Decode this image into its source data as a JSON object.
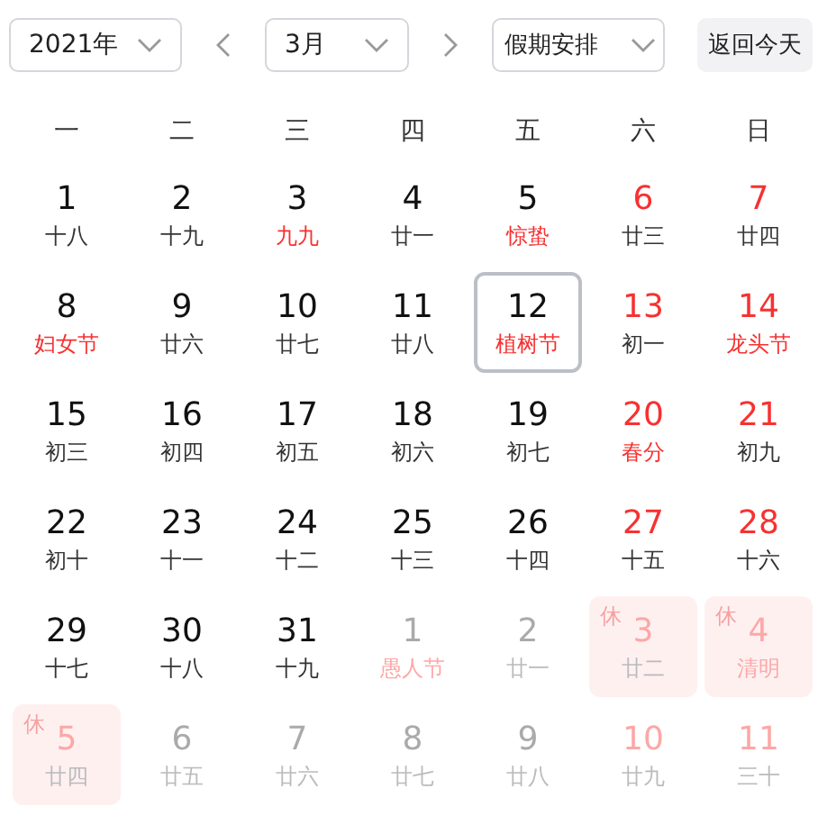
{
  "toolbar": {
    "year": "2021年",
    "month": "3月",
    "holiday": "假期安排",
    "today_button": "返回今天"
  },
  "weekdays": [
    "一",
    "二",
    "三",
    "四",
    "五",
    "六",
    "日"
  ],
  "days": [
    {
      "day": "1",
      "lunar": "十八",
      "red": false,
      "festival": false,
      "other_month": false,
      "selected": false
    },
    {
      "day": "2",
      "lunar": "十九",
      "red": false,
      "festival": false,
      "other_month": false,
      "selected": false
    },
    {
      "day": "3",
      "lunar": "九九",
      "red": false,
      "festival": true,
      "other_month": false,
      "selected": false
    },
    {
      "day": "4",
      "lunar": "廿一",
      "red": false,
      "festival": false,
      "other_month": false,
      "selected": false
    },
    {
      "day": "5",
      "lunar": "惊蛰",
      "red": false,
      "festival": true,
      "other_month": false,
      "selected": false
    },
    {
      "day": "6",
      "lunar": "廿三",
      "red": true,
      "festival": false,
      "other_month": false,
      "selected": false
    },
    {
      "day": "7",
      "lunar": "廿四",
      "red": true,
      "festival": false,
      "other_month": false,
      "selected": false
    },
    {
      "day": "8",
      "lunar": "妇女节",
      "red": false,
      "festival": true,
      "other_month": false,
      "selected": false
    },
    {
      "day": "9",
      "lunar": "廿六",
      "red": false,
      "festival": false,
      "other_month": false,
      "selected": false
    },
    {
      "day": "10",
      "lunar": "廿七",
      "red": false,
      "festival": false,
      "other_month": false,
      "selected": false
    },
    {
      "day": "11",
      "lunar": "廿八",
      "red": false,
      "festival": false,
      "other_month": false,
      "selected": false
    },
    {
      "day": "12",
      "lunar": "植树节",
      "red": false,
      "festival": true,
      "other_month": false,
      "selected": true
    },
    {
      "day": "13",
      "lunar": "初一",
      "red": true,
      "festival": false,
      "other_month": false,
      "selected": false
    },
    {
      "day": "14",
      "lunar": "龙头节",
      "red": true,
      "festival": true,
      "other_month": false,
      "selected": false
    },
    {
      "day": "15",
      "lunar": "初三",
      "red": false,
      "festival": false,
      "other_month": false,
      "selected": false
    },
    {
      "day": "16",
      "lunar": "初四",
      "red": false,
      "festival": false,
      "other_month": false,
      "selected": false
    },
    {
      "day": "17",
      "lunar": "初五",
      "red": false,
      "festival": false,
      "other_month": false,
      "selected": false
    },
    {
      "day": "18",
      "lunar": "初六",
      "red": false,
      "festival": false,
      "other_month": false,
      "selected": false
    },
    {
      "day": "19",
      "lunar": "初七",
      "red": false,
      "festival": false,
      "other_month": false,
      "selected": false
    },
    {
      "day": "20",
      "lunar": "春分",
      "red": true,
      "festival": true,
      "other_month": false,
      "selected": false
    },
    {
      "day": "21",
      "lunar": "初九",
      "red": true,
      "festival": false,
      "other_month": false,
      "selected": false
    },
    {
      "day": "22",
      "lunar": "初十",
      "red": false,
      "festival": false,
      "other_month": false,
      "selected": false
    },
    {
      "day": "23",
      "lunar": "十一",
      "red": false,
      "festival": false,
      "other_month": false,
      "selected": false
    },
    {
      "day": "24",
      "lunar": "十二",
      "red": false,
      "festival": false,
      "other_month": false,
      "selected": false
    },
    {
      "day": "25",
      "lunar": "十三",
      "red": false,
      "festival": false,
      "other_month": false,
      "selected": false
    },
    {
      "day": "26",
      "lunar": "十四",
      "red": false,
      "festival": false,
      "other_month": false,
      "selected": false
    },
    {
      "day": "27",
      "lunar": "十五",
      "red": true,
      "festival": false,
      "other_month": false,
      "selected": false
    },
    {
      "day": "28",
      "lunar": "十六",
      "red": true,
      "festival": false,
      "other_month": false,
      "selected": false
    },
    {
      "day": "29",
      "lunar": "十七",
      "red": false,
      "festival": false,
      "other_month": false,
      "selected": false
    },
    {
      "day": "30",
      "lunar": "十八",
      "red": false,
      "festival": false,
      "other_month": false,
      "selected": false
    },
    {
      "day": "31",
      "lunar": "十九",
      "red": false,
      "festival": false,
      "other_month": false,
      "selected": false
    },
    {
      "day": "1",
      "lunar": "愚人节",
      "red": false,
      "festival": true,
      "other_month": true,
      "selected": false
    },
    {
      "day": "2",
      "lunar": "廿一",
      "red": false,
      "festival": false,
      "other_month": true,
      "selected": false
    },
    {
      "day": "3",
      "lunar": "廿二",
      "red": true,
      "festival": false,
      "other_month": true,
      "selected": false,
      "rest_label": "休"
    },
    {
      "day": "4",
      "lunar": "清明",
      "red": true,
      "festival": true,
      "other_month": true,
      "selected": false,
      "rest_label": "休"
    },
    {
      "day": "5",
      "lunar": "廿四",
      "red": true,
      "festival": false,
      "other_month": true,
      "selected": false,
      "rest_label": "休"
    },
    {
      "day": "6",
      "lunar": "廿五",
      "red": false,
      "festival": false,
      "other_month": true,
      "selected": false
    },
    {
      "day": "7",
      "lunar": "廿六",
      "red": false,
      "festival": false,
      "other_month": true,
      "selected": false
    },
    {
      "day": "8",
      "lunar": "廿七",
      "red": false,
      "festival": false,
      "other_month": true,
      "selected": false
    },
    {
      "day": "9",
      "lunar": "廿八",
      "red": false,
      "festival": false,
      "other_month": true,
      "selected": false
    },
    {
      "day": "10",
      "lunar": "廿九",
      "red": true,
      "festival": false,
      "other_month": true,
      "selected": false
    },
    {
      "day": "11",
      "lunar": "三十",
      "red": true,
      "festival": false,
      "other_month": true,
      "selected": false
    }
  ]
}
